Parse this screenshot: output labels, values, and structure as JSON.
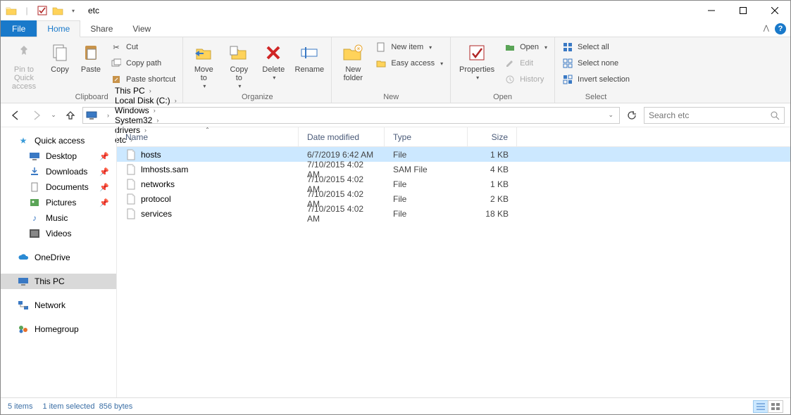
{
  "window": {
    "title": "etc"
  },
  "tabs": {
    "file": "File",
    "home": "Home",
    "share": "Share",
    "view": "View"
  },
  "ribbon": {
    "clipboard": {
      "label": "Clipboard",
      "pin": "Pin to Quick\naccess",
      "copy": "Copy",
      "paste": "Paste",
      "cut": "Cut",
      "copy_path": "Copy path",
      "paste_shortcut": "Paste shortcut"
    },
    "organize": {
      "label": "Organize",
      "move": "Move\nto",
      "copyto": "Copy\nto",
      "delete": "Delete",
      "rename": "Rename"
    },
    "new": {
      "label": "New",
      "new_folder": "New\nfolder",
      "new_item": "New item",
      "easy_access": "Easy access"
    },
    "open": {
      "label": "Open",
      "properties": "Properties",
      "open": "Open",
      "edit": "Edit",
      "history": "History"
    },
    "select": {
      "label": "Select",
      "all": "Select all",
      "none": "Select none",
      "invert": "Invert selection"
    }
  },
  "breadcrumbs": [
    "This PC",
    "Local Disk (C:)",
    "Windows",
    "System32",
    "drivers",
    "etc"
  ],
  "search": {
    "placeholder": "Search etc"
  },
  "columns": {
    "name": "Name",
    "date": "Date modified",
    "type": "Type",
    "size": "Size"
  },
  "files": [
    {
      "name": "hosts",
      "date": "6/7/2019 6:42 AM",
      "type": "File",
      "size": "1 KB",
      "selected": true
    },
    {
      "name": "lmhosts.sam",
      "date": "7/10/2015 4:02 AM",
      "type": "SAM File",
      "size": "4 KB",
      "selected": false
    },
    {
      "name": "networks",
      "date": "7/10/2015 4:02 AM",
      "type": "File",
      "size": "1 KB",
      "selected": false
    },
    {
      "name": "protocol",
      "date": "7/10/2015 4:02 AM",
      "type": "File",
      "size": "2 KB",
      "selected": false
    },
    {
      "name": "services",
      "date": "7/10/2015 4:02 AM",
      "type": "File",
      "size": "18 KB",
      "selected": false
    }
  ],
  "nav": {
    "quick_access": "Quick access",
    "desktop": "Desktop",
    "downloads": "Downloads",
    "documents": "Documents",
    "pictures": "Pictures",
    "music": "Music",
    "videos": "Videos",
    "onedrive": "OneDrive",
    "this_pc": "This PC",
    "network": "Network",
    "homegroup": "Homegroup"
  },
  "status": {
    "count": "5 items",
    "selection": "1 item selected",
    "size": "856 bytes"
  }
}
